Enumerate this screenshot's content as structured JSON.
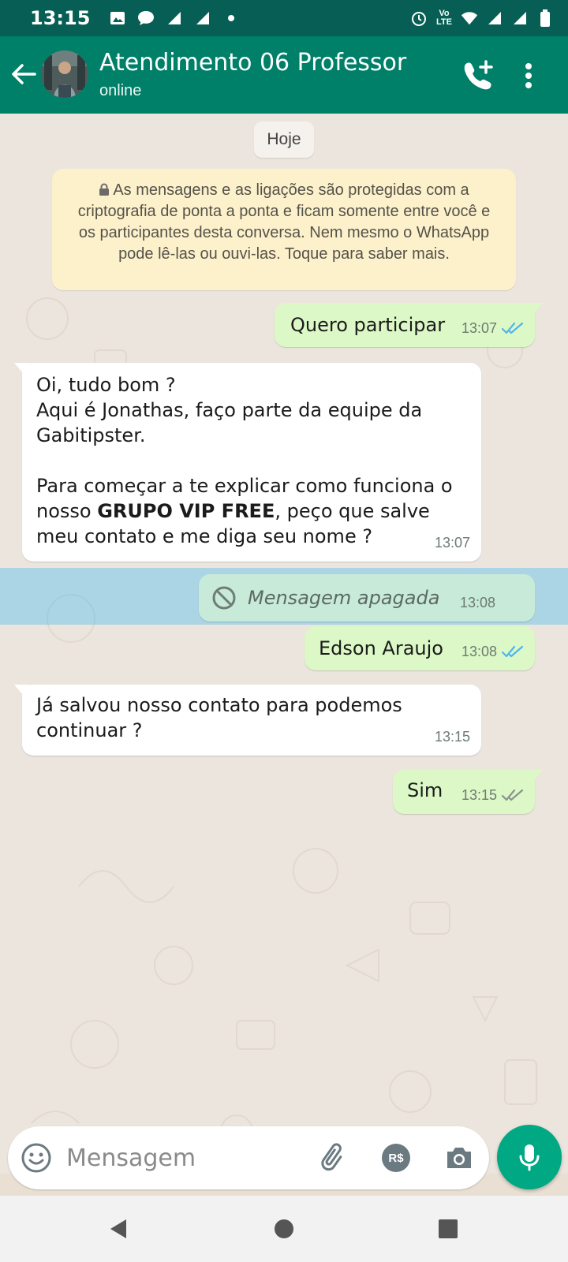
{
  "status_bar": {
    "time": "13:15",
    "icons": [
      "image-icon",
      "chat-icon",
      "signal-icon",
      "signal-icon",
      "dot-icon",
      "alarm-icon",
      "volte-icon",
      "wifi-icon",
      "signal-icon",
      "signal-icon",
      "battery-icon"
    ],
    "volte_top": "Vo",
    "volte_bottom": "LTE"
  },
  "header": {
    "title": "Atendimento 06 Professor",
    "status": "online",
    "icons": [
      "arrow-back-icon",
      "add-call-icon",
      "more-vert-icon"
    ]
  },
  "chat": {
    "date_chip": "Hoje",
    "encryption_notice": "As mensagens e as ligações são protegidas com a criptografia de ponta a ponta e ficam somente entre você e os participantes desta conversa. Nem mesmo o WhatsApp pode lê-las ou ouvi-las. Toque para saber mais.",
    "messages": [
      {
        "direction": "out",
        "text": "Quero participar",
        "time": "13:07",
        "status": "read"
      },
      {
        "direction": "in",
        "line1": "Oi, tudo bom ?",
        "line2": "Aqui é Jonathas, faço parte da equipe  da Gabitipster.",
        "line3_pre": "Para começar a te explicar como funciona o nosso ",
        "line3_bold": "GRUPO VIP FREE",
        "line3_post": ", peço que salve meu contato e me diga seu nome ?",
        "time": "13:07"
      },
      {
        "direction": "out",
        "text": "Mensagem apagada",
        "time": "13:08",
        "deleted": true
      },
      {
        "direction": "out",
        "text": "Edson Araujo",
        "time": "13:08",
        "status": "read"
      },
      {
        "direction": "in",
        "text": "Já salvou nosso contato para podemos continuar ?",
        "time": "13:15"
      },
      {
        "direction": "out",
        "text": "Sim",
        "time": "13:15",
        "status": "delivered"
      }
    ]
  },
  "composer": {
    "placeholder": "Mensagem",
    "pay_label": "R$",
    "icons": [
      "emoji-icon",
      "attach-icon",
      "payment-icon",
      "camera-icon",
      "mic-icon"
    ]
  },
  "colors": {
    "header": "#008069",
    "status_bar": "#075e54",
    "outgoing_bubble": "#dcf8c6",
    "incoming_bubble": "#ffffff",
    "read_ticks": "#4fb6ec",
    "mic_button": "#00a884"
  }
}
